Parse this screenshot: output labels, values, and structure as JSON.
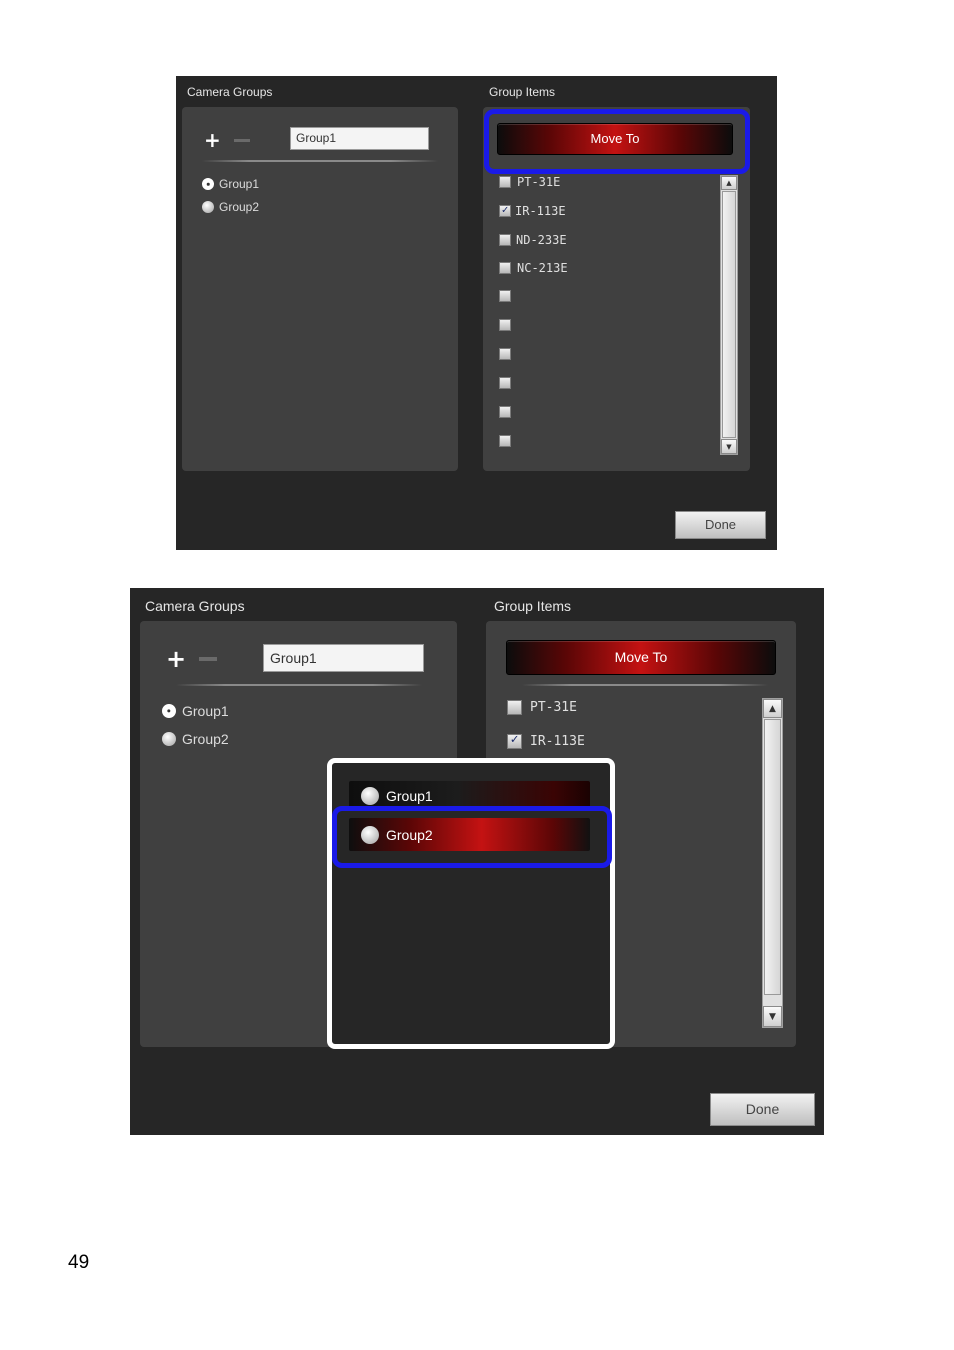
{
  "screen1": {
    "camera_groups_title": "Camera Groups",
    "group_items_title": "Group Items",
    "group_name_value": "Group1",
    "groups": [
      {
        "label": "Group1",
        "selected": true
      },
      {
        "label": "Group2",
        "selected": false
      }
    ],
    "move_to_label": "Move To",
    "items": [
      {
        "label": "PT-31E",
        "checked": false
      },
      {
        "label": "IR-113E",
        "checked": true
      },
      {
        "label": "ND-233E",
        "checked": false
      },
      {
        "label": "NC-213E",
        "checked": false
      },
      {
        "label": "",
        "checked": false
      },
      {
        "label": "",
        "checked": false
      },
      {
        "label": "",
        "checked": false
      },
      {
        "label": "",
        "checked": false
      },
      {
        "label": "",
        "checked": false
      },
      {
        "label": "",
        "checked": false
      }
    ],
    "done_label": "Done"
  },
  "screen2": {
    "camera_groups_title": "Camera Groups",
    "group_items_title": "Group Items",
    "group_name_value": "Group1",
    "groups": [
      {
        "label": "Group1",
        "selected": true
      },
      {
        "label": "Group2",
        "selected": false
      }
    ],
    "move_to_label": "Move To",
    "items": [
      {
        "label": "PT-31E",
        "checked": false
      },
      {
        "label": "IR-113E",
        "checked": true
      }
    ],
    "popup_options": [
      {
        "label": "Group1"
      },
      {
        "label": "Group2"
      }
    ],
    "done_label": "Done"
  },
  "page_number": "49",
  "colors": {
    "window_bg": "#262626",
    "panel_bg": "#404040",
    "accent_red": "#c41212",
    "highlight_blue": "#1a1ae8"
  },
  "icons": {
    "add": "plus-icon",
    "remove": "minus-icon",
    "scroll_up": "chevron-up-icon",
    "scroll_down": "chevron-down-icon"
  }
}
